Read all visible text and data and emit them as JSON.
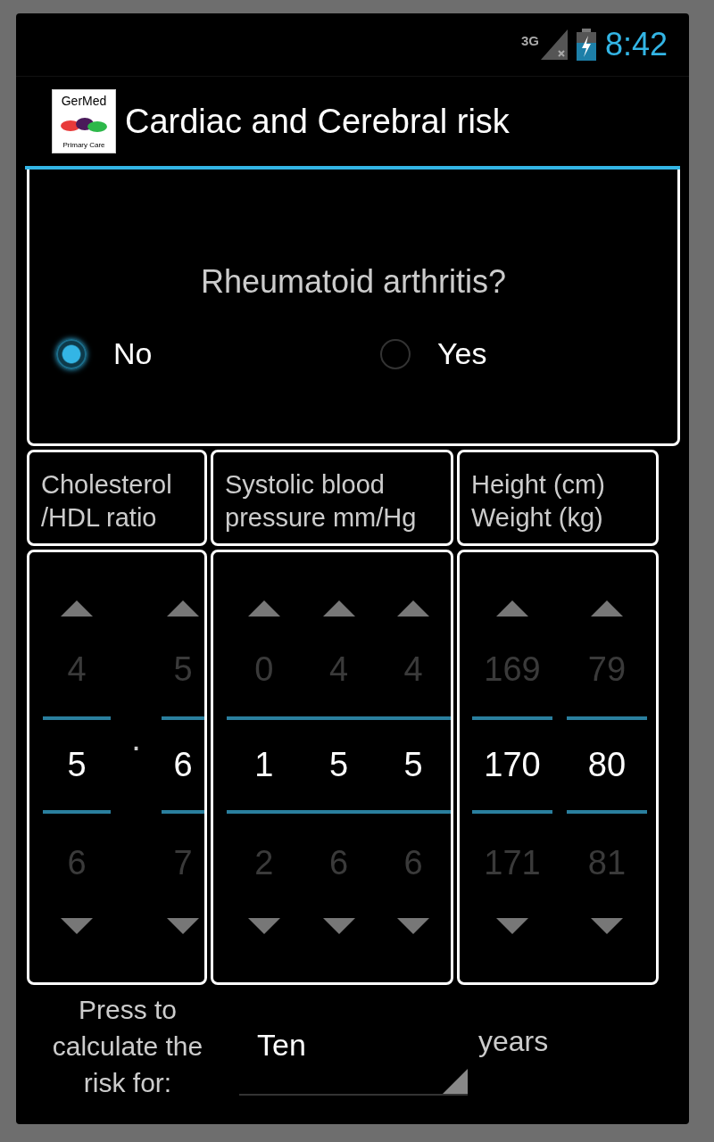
{
  "status_bar": {
    "network": "3G",
    "time": "8:42"
  },
  "action_bar": {
    "logo": {
      "line_1": "GerMed",
      "line_2": "Primary Care"
    },
    "title": "Cardiac and Cerebral risk"
  },
  "question": {
    "text": "Rheumatoid arthritis?",
    "options": [
      {
        "label": "No",
        "selected": true
      },
      {
        "label": "Yes",
        "selected": false
      }
    ]
  },
  "pickers": [
    {
      "header": "Cholesterol\n/HDL ratio",
      "separator": ".",
      "columns": [
        {
          "prev": "4",
          "value": "5",
          "next": "6"
        },
        {
          "prev": "5",
          "value": "6",
          "next": "7"
        }
      ]
    },
    {
      "header": "Systolic blood\npressure mm/Hg",
      "columns": [
        {
          "prev": "0",
          "value": "1",
          "next": "2"
        },
        {
          "prev": "4",
          "value": "5",
          "next": "6"
        },
        {
          "prev": "4",
          "value": "5",
          "next": "6"
        }
      ]
    },
    {
      "header": "Height (cm)\nWeight (kg)",
      "columns": [
        {
          "prev": "169",
          "value": "170",
          "next": "171"
        },
        {
          "prev": "79",
          "value": "80",
          "next": "81"
        }
      ]
    }
  ],
  "calculate": {
    "label_lines": [
      "Press to",
      "calculate the",
      "risk for:"
    ],
    "spinner_value": "Ten",
    "unit": "years"
  }
}
